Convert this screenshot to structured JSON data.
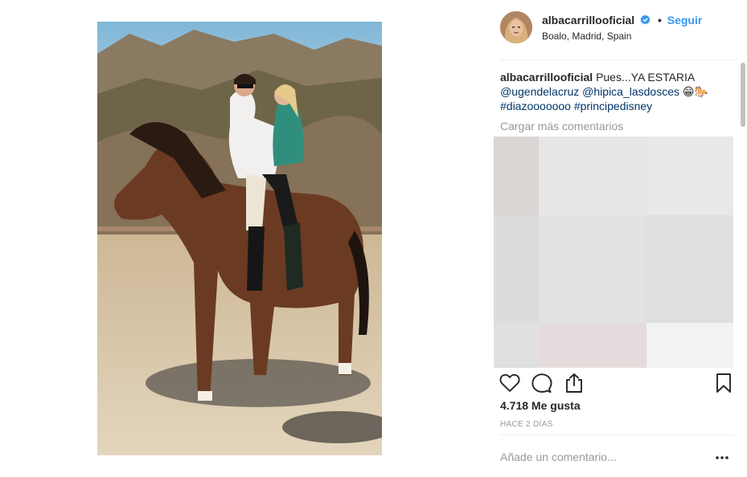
{
  "post": {
    "username": "albacarrillooficial",
    "verified": true,
    "follow_label": "Seguir",
    "location": "Boalo, Madrid, Spain",
    "caption": {
      "author": "albacarrillooficial",
      "text": "Pues...YA ESTARIA",
      "mentions": [
        "@ugendelacruz",
        "@hipica_lasdosces"
      ],
      "emojis": "😁🐎",
      "hashtags": [
        "#diazooooooo",
        "#principedisney"
      ]
    },
    "load_more_label": "Cargar más comentarios",
    "likes": "4.718 Me gusta",
    "time_ago": "HACE 2 DÍAS",
    "comment_placeholder": "Añade un comentario...",
    "more_glyph": "•••"
  },
  "icons": {
    "verified": "verified-badge-icon",
    "like": "heart-icon",
    "comment": "comment-bubble-icon",
    "share": "share-icon",
    "save": "bookmark-icon",
    "more": "more-options-icon"
  },
  "colors": {
    "link": "#003569",
    "accent": "#3897f0",
    "secondary_text": "#999999",
    "divider": "#efefef",
    "pixel_tiles": [
      "#d9d6d3",
      "#e6e6e8",
      "#e8e8ea",
      "#dcdcde",
      "#e2e2e4",
      "#dedfe1",
      "#e4dcdc",
      "#f2f2f2"
    ]
  }
}
